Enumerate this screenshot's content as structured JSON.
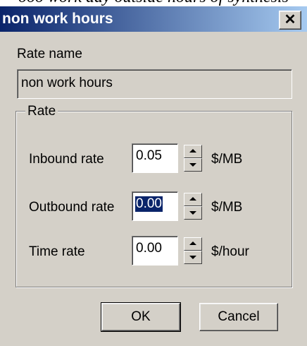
{
  "background_text": "ooo work day outside hours of synthesis",
  "window": {
    "title": "non work hours",
    "close_glyph": "✕"
  },
  "rate_name": {
    "label": "Rate name",
    "value": "non work hours"
  },
  "rate_group": {
    "label": "Rate",
    "rows": [
      {
        "label": "Inbound rate",
        "value": "0.05",
        "unit": "$/MB",
        "selected": false
      },
      {
        "label": "Outbound rate",
        "value": "0.00",
        "unit": "$/MB",
        "selected": true
      },
      {
        "label": "Time rate",
        "value": "0.00",
        "unit": "$/hour",
        "selected": false
      }
    ]
  },
  "buttons": {
    "ok": "OK",
    "cancel": "Cancel"
  },
  "colors": {
    "titlebar_start": "#0a246a",
    "titlebar_end": "#a6caf0",
    "face": "#d4d0c8",
    "selection": "#0a246a"
  }
}
